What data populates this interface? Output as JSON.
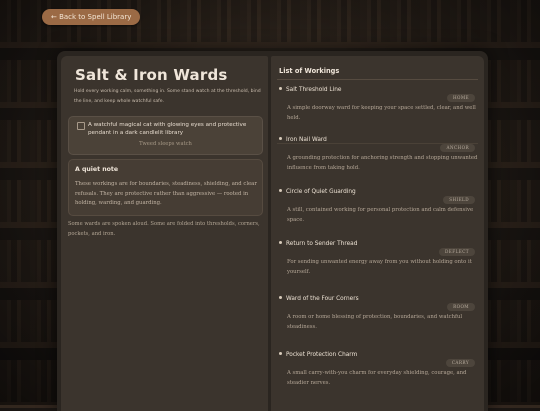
{
  "nav": {
    "back_label": "← Back to Spell Library"
  },
  "left_page": {
    "title": "Salt & Iron Wards",
    "intro": "Hold every working calm, something in. Some stand watch at the threshold, bind the line, and keep whole watchful safe.",
    "image": {
      "alt": "A watchful magical cat with glowing eyes and protective pendant in a dark candlelit library",
      "caption": "Tweed sleeps watch"
    },
    "note": {
      "title": "A quiet note",
      "body": "These workings are for boundaries, steadiness, shielding, and clear refusals. They are protective rather than aggressive — rooted in holding, warding, and guarding."
    },
    "footer": "Some wards are spoken aloud. Some are folded into thresholds, corners, pockets, and iron."
  },
  "right_page": {
    "title": "List of Workings",
    "items": [
      {
        "name": "Salt Threshold Line",
        "tag": "HOME",
        "desc": "A simple doorway ward for keeping your space settled, clear, and well held."
      },
      {
        "name": "Iron Nail Ward",
        "tag": "ANCHOR",
        "desc": "A grounding protection for anchoring strength and stopping unwanted influence from taking hold."
      },
      {
        "name": "Circle of Quiet Guarding",
        "tag": "SHIELD",
        "desc": "A still, contained working for personal protection and calm defensive space."
      },
      {
        "name": "Return to Sender Thread",
        "tag": "DEFLECT",
        "desc": "For sending unwanted energy away from you without holding onto it yourself."
      },
      {
        "name": "Ward of the Four Corners",
        "tag": "ROOM",
        "desc": "A room or home blessing of protection, boundaries, and watchful steadiness."
      },
      {
        "name": "Pocket Protection Charm",
        "tag": "CARRY",
        "desc": "A small carry-with-you charm for everyday shielding, courage, and steadier nerves."
      }
    ]
  },
  "colors": {
    "accent": "#9b6a45",
    "page": "#3b342d",
    "cover": "#2a2520"
  },
  "icons": {
    "back": "arrow-left-icon",
    "bullet": "bullet-icon",
    "image": "broken-image-icon"
  }
}
